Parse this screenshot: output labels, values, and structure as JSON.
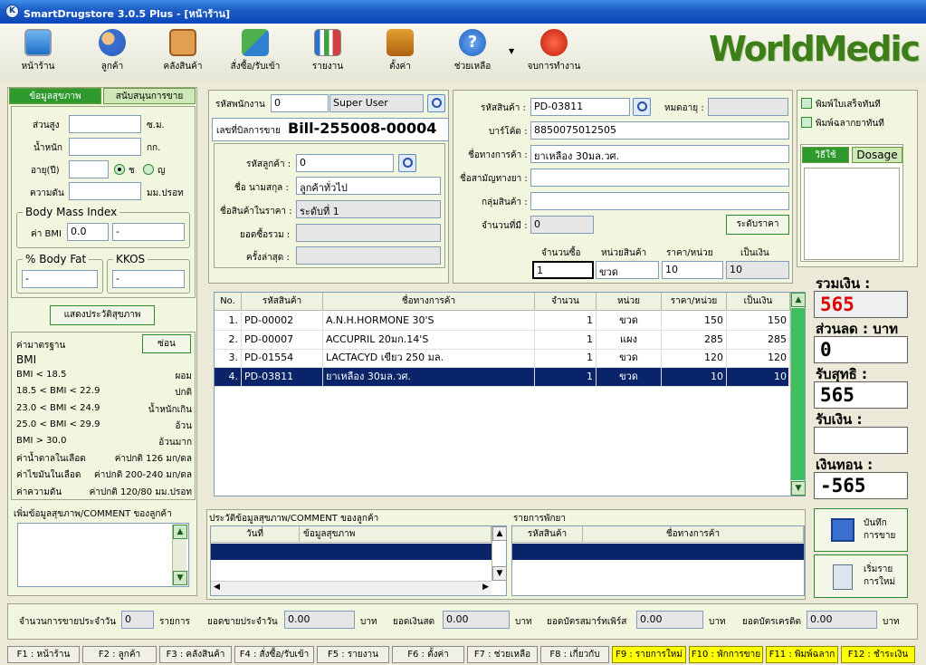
{
  "app": {
    "title": "SmartDrugstore 3.0.5 Plus  - [หน้าร้าน]",
    "logo": "WorldMedic"
  },
  "toolbar": [
    {
      "label": "หน้าร้าน",
      "icon": "monitor-icon"
    },
    {
      "label": "ลูกค้า",
      "icon": "users-icon"
    },
    {
      "label": "คลังสินค้า",
      "icon": "warehouse-icon"
    },
    {
      "label": "สั่งซื้อ/รับเข้า",
      "icon": "exchange-icon"
    },
    {
      "label": "รายงาน",
      "icon": "report-chart-icon"
    },
    {
      "label": "ตั้งค่า",
      "icon": "tools-icon"
    },
    {
      "label": "ช่วยเหลือ",
      "icon": "help-icon"
    },
    {
      "label": "จบการทำงาน",
      "icon": "power-icon"
    }
  ],
  "left": {
    "tabs": [
      "ข้อมูลสุขภาพ",
      "สนับสนุนการขาย"
    ],
    "height_label": "ส่วนสูง",
    "height_unit": "ซ.ม.",
    "weight_label": "น้ำหนัก",
    "weight_unit": "กก.",
    "age_label": "อายุ(ปี)",
    "male": "ช",
    "female": "ญ",
    "bp_label": "ความดัน",
    "bp_unit": "มม.ปรอท",
    "bmi_title": "Body Mass Index",
    "bmi_label": "ค่า BMI",
    "bmi_value": "0.0",
    "bmi_desc": "-",
    "bodyfat_title": "% Body Fat",
    "bodyfat_value": "-",
    "kkos_title": "KKOS",
    "kkos_value": "-",
    "history_btn": "แสดงประวัติสุขภาพ",
    "std_title": "ค่ามาตรฐาน",
    "hide_btn": "ซ่อน",
    "std_rows": [
      {
        "a": "BMI",
        "b": ""
      },
      {
        "a": "BMI < 18.5",
        "b": "ผอม"
      },
      {
        "a": "18.5 < BMI < 22.9",
        "b": "ปกติ"
      },
      {
        "a": "23.0 < BMI < 24.9",
        "b": "น้ำหนักเกิน"
      },
      {
        "a": "25.0 < BMI < 29.9",
        "b": "อ้วน"
      },
      {
        "a": "BMI > 30.0",
        "b": "อ้วนมาก"
      },
      {
        "a": "ค่าน้ำตาลในเลือด",
        "b": "ค่าปกติ 126 มก/ดล"
      },
      {
        "a": "ค่าไขมันในเลือด",
        "b": "ค่าปกติ 200-240 มก/ดล"
      },
      {
        "a": "ค่าความดัน",
        "b": "ค่าปกติ 120/80 มม.ปรอท"
      }
    ],
    "comment_label": "เพิ่มข้อมูลสุขภาพ/COMMENT ของลูกค้า"
  },
  "bill": {
    "emp_label": "รหัสพนักงาน",
    "emp_id": "0",
    "emp_name": "Super User",
    "bill_label": "เลขที่บิลการขาย",
    "bill_no": "Bill-255008-00004",
    "cust_label": "รหัสลูกค้า :",
    "cust_id": "0",
    "name_label": "ชื่อ นามสกุล :",
    "name_value": "ลูกค้าทั่วไป",
    "price_label": "ชื่อสินค้าในราคา :",
    "price_value": "ระดับที่ 1",
    "total_label": "ยอดซื้อรวม :",
    "last_label": "ครั้งล่าสุด :"
  },
  "product": {
    "code_label": "รหัสสินค้า :",
    "code": "PD-03811",
    "expire_label": "หมดอายุ :",
    "barcode_label": "บาร์โค้ด :",
    "barcode": "8850075012505",
    "trade_label": "ชื่อทางการค้า :",
    "trade": "ยาเหลือง 30มล.วศ.",
    "generic_label": "ชื่อสามัญทางยา :",
    "group_label": "กลุ่มสินค้า :",
    "stock_label": "จำนวนที่มี :",
    "stock": "0",
    "level_btn": "ระดับราคา",
    "qty_label": "จำนวนซื้อ",
    "unit_label": "หน่วยสินค้า",
    "unitprice_label": "ราคา/หน่วย",
    "amount_label": "เป็นเงิน",
    "qty": "1",
    "unit": "ขวด",
    "unitprice": "10",
    "amount": "10"
  },
  "options": {
    "print_receipt": "พิมพ์ใบเสร็จทันที",
    "print_label": "พิมพ์ฉลากยาทันที",
    "tab_usage": "วิธีใช้",
    "tab_dosage": "Dosage"
  },
  "table": {
    "headers": [
      "No.",
      "รหัสสินค้า",
      "ชื่อทางการค้า",
      "จำนวน",
      "หน่วย",
      "ราคา/หน่วย",
      "เป็นเงิน"
    ],
    "rows": [
      [
        "1.",
        "PD-00002",
        "A.N.H.HORMONE 30'S",
        "1",
        "ขวด",
        "150",
        "150"
      ],
      [
        "2.",
        "PD-00007",
        "ACCUPRIL 20มก.14'S",
        "1",
        "แผง",
        "285",
        "285"
      ],
      [
        "3.",
        "PD-01554",
        "LACTACYD เขียว 250 มล.",
        "1",
        "ขวด",
        "120",
        "120"
      ],
      [
        "4.",
        "PD-03811",
        "ยาเหลือง 30มล.วศ.",
        "1",
        "ขวด",
        "10",
        "10"
      ]
    ]
  },
  "totals": {
    "total_label": "รวมเงิน :",
    "total": "565",
    "discount_label": "ส่วนลด : บาท",
    "discount": "0",
    "net_label": "รับสุทธิ :",
    "net": "565",
    "received_label": "รับเงิน :",
    "received": "",
    "change_label": "เงินทอน :",
    "change": "-565"
  },
  "history": {
    "title": "ประวัติข้อมูลสุขภาพ/COMMENT ของลูกค้า",
    "col_date": "วันที่",
    "col_info": "ข้อมูลสุขภาพ"
  },
  "hold": {
    "title": "รายการพักยา",
    "col_code": "รหัสสินค้า",
    "col_name": "ชื่อทางการค้า"
  },
  "actions": {
    "save": "บันทึก\nการขาย",
    "new": "เริ่มราย\nการใหม่"
  },
  "summary": {
    "count_label": "จำนวนการขายประจำวัน",
    "count": "0",
    "count_unit": "รายการ",
    "sales_label": "ยอดขายประจำวัน",
    "sales": "0.00",
    "baht": "บาท",
    "cash_label": "ยอดเงินสด",
    "cash": "0.00",
    "smart_label": "ยอดบัตรสมาร์ทเพิร์ส",
    "smart": "0.00",
    "credit_label": "ยอดบัตรเครดิต",
    "credit": "0.00"
  },
  "fkeys": [
    "F1 : หน้าร้าน",
    "F2 : ลูกค้า",
    "F3 : คลังสินค้า",
    "F4 : สั่งซื้อ/รับเข้า",
    "F5 : รายงาน",
    "F6 : ตั้งค่า",
    "F7 : ช่วยเหลือ",
    "F8 : เกี่ยวกับ",
    "F9 : รายการใหม่",
    "F10 : พักการขาย",
    "F11 : พิมพ์ฉลาก",
    "F12 : ชำระเงิน"
  ],
  "colors": {
    "accent": "#2e8a2e",
    "selected": "#0a246a",
    "total_red": "#e00000"
  }
}
